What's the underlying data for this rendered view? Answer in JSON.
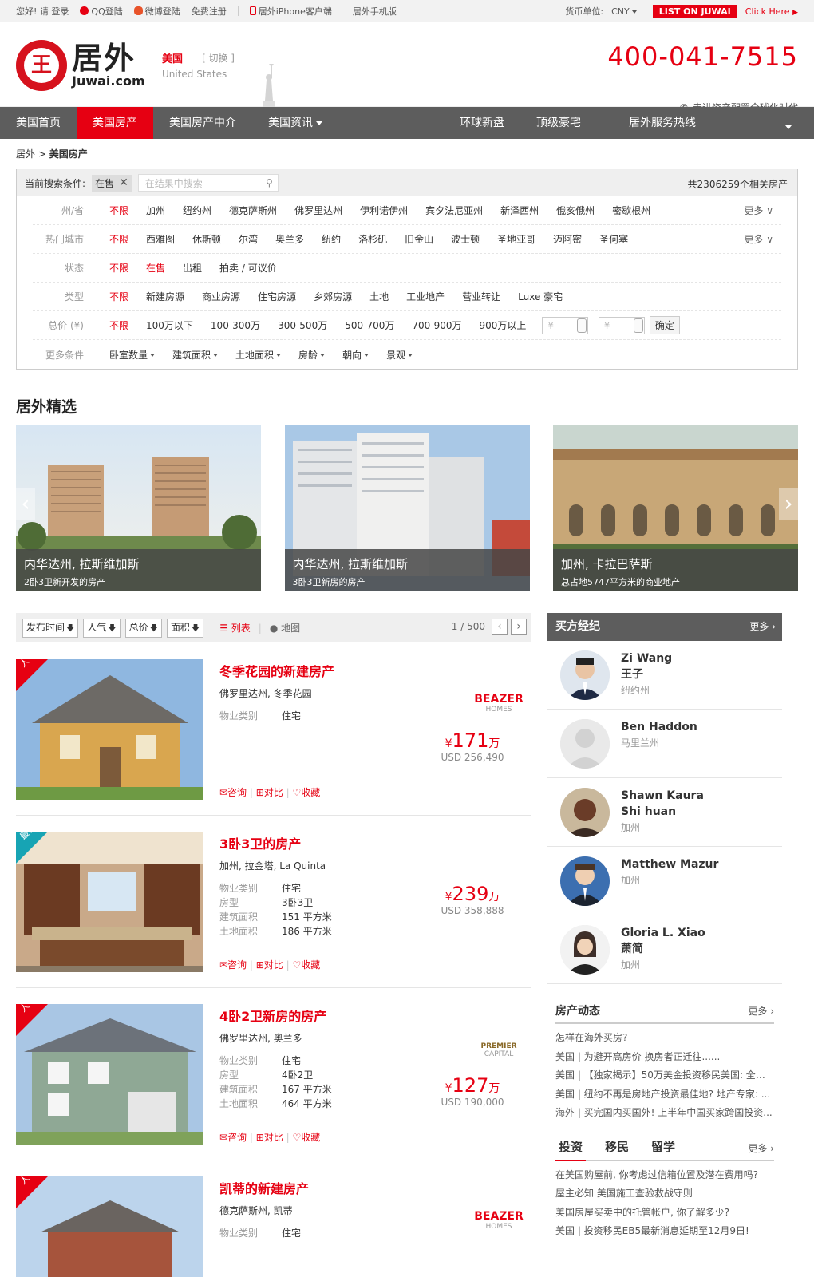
{
  "topbar": {
    "greeting": "您好! 请 登录",
    "qq_login": "QQ登陆",
    "weibo_login": "微博登陆",
    "register": "免费注册",
    "iphone_client": "居外iPhone客户端",
    "mobile_site": "居外手机版",
    "currency_label": "货币单位:",
    "currency_value": "CNY",
    "list_on": "LIST ON JUWAI",
    "click_here": "Click Here"
  },
  "header": {
    "logo_cn": "居外",
    "logo_en": "Juwai.com",
    "country": "美国",
    "switch": "[ 切换 ]",
    "country_en": "United States",
    "phone": "400-041-7515",
    "slogan": "走进资产配置全球化时代"
  },
  "nav": {
    "items": [
      "美国首页",
      "美国房产",
      "美国房产中介",
      "美国资讯"
    ],
    "right_items": [
      "环球新盘",
      "顶级豪宅",
      "居外服务热线"
    ]
  },
  "breadcrumb": {
    "root": "居外",
    "sep": ">",
    "current": "美国房产"
  },
  "filter": {
    "current_label": "当前搜索条件:",
    "tag": "在售",
    "search_placeholder": "在结果中搜索",
    "count": "共2306259个相关房产",
    "rows": [
      {
        "label": "州/省",
        "options": [
          "不限",
          "加州",
          "纽约州",
          "德克萨斯州",
          "佛罗里达州",
          "伊利诺伊州",
          "宾夕法尼亚州",
          "新泽西州",
          "俄亥俄州",
          "密歇根州"
        ],
        "more": "更多"
      },
      {
        "label": "热门城市",
        "options": [
          "不限",
          "西雅图",
          "休斯顿",
          "尔湾",
          "奥兰多",
          "纽约",
          "洛杉矶",
          "旧金山",
          "波士顿",
          "圣地亚哥",
          "迈阿密",
          "圣何塞"
        ],
        "more": "更多"
      },
      {
        "label": "状态",
        "options": [
          "不限",
          "在售",
          "出租",
          "拍卖 / 可议价"
        ]
      },
      {
        "label": "类型",
        "options": [
          "不限",
          "新建房源",
          "商业房源",
          "住宅房源",
          "乡郊房源",
          "土地",
          "工业地产",
          "营业转让",
          "Luxe 豪宅"
        ]
      },
      {
        "label": "总价 (¥)",
        "options": [
          "不限",
          "100万以下",
          "100-300万",
          "300-500万",
          "500-700万",
          "700-900万",
          "900万以上"
        ]
      },
      {
        "label": "更多条件",
        "options": [
          "卧室数量",
          "建筑面积",
          "土地面积",
          "房龄",
          "朝向",
          "景观"
        ]
      }
    ],
    "range_placeholder": "¥",
    "range_sep": "-",
    "confirm": "确定"
  },
  "featured": {
    "title": "居外精选",
    "cards": [
      {
        "title": "内华达州, 拉斯维加斯",
        "sub": "2卧3卫新开发的房产"
      },
      {
        "title": "内华达州, 拉斯维加斯",
        "sub": "3卧3卫新房的房产"
      },
      {
        "title": "加州, 卡拉巴萨斯",
        "sub": "总占地5747平方米的商业地产"
      }
    ]
  },
  "sort": {
    "buttons": [
      "发布时间",
      "人气",
      "总价",
      "面积"
    ],
    "list_view": "列表",
    "map_view": "地图",
    "page": "1 / 500"
  },
  "listings": [
    {
      "ribbon": "人气",
      "title": "冬季花园的新建房产",
      "location": "佛罗里达州, 冬季花园",
      "props": [
        {
          "k": "物业类别",
          "v": "住宅"
        }
      ],
      "price_num": "171",
      "price_unit": "万",
      "price_sym": "¥",
      "usd": "USD 256,490",
      "brand": "BEAZER",
      "brand_sub": "HOMES"
    },
    {
      "ribbon": "最新",
      "title": "3卧3卫的房产",
      "location": "加州, 拉金塔, La Quinta",
      "props": [
        {
          "k": "物业类别",
          "v": "住宅"
        },
        {
          "k": "房型",
          "v": "3卧3卫"
        },
        {
          "k": "建筑面积",
          "v": "151 平方米"
        },
        {
          "k": "土地面积",
          "v": "186 平方米"
        }
      ],
      "price_num": "239",
      "price_unit": "万",
      "price_sym": "¥",
      "usd": "USD 358,888"
    },
    {
      "ribbon": "人气",
      "title": "4卧2卫新房的房产",
      "location": "佛罗里达州, 奥兰多",
      "props": [
        {
          "k": "物业类别",
          "v": "住宅"
        },
        {
          "k": "房型",
          "v": "4卧2卫"
        },
        {
          "k": "建筑面积",
          "v": "167 平方米"
        },
        {
          "k": "土地面积",
          "v": "464 平方米"
        }
      ],
      "price_num": "127",
      "price_unit": "万",
      "price_sym": "¥",
      "usd": "USD 190,000",
      "brand": "PREMIER",
      "brand_sub": "CAPITAL"
    },
    {
      "ribbon": "人气",
      "title": "凯蒂的新建房产",
      "location": "德克萨斯州, 凯蒂",
      "props": [
        {
          "k": "物业类别",
          "v": "住宅"
        }
      ],
      "brand": "BEAZER",
      "brand_sub": "HOMES"
    }
  ],
  "actions": {
    "consult": "咨询",
    "compare": "对比",
    "favorite": "收藏"
  },
  "agents": {
    "title": "买方经纪",
    "more": "更多",
    "list": [
      {
        "name": "Zi Wang",
        "name2": "王子",
        "loc": "纽约州"
      },
      {
        "name": "Ben Haddon",
        "name2": "",
        "loc": "马里兰州"
      },
      {
        "name": "Shawn Kaura",
        "name2": "Shi huan",
        "loc": "加州"
      },
      {
        "name": "Matthew Mazur",
        "name2": "",
        "loc": "加州"
      },
      {
        "name": "Gloria L. Xiao",
        "name2": "萧简",
        "loc": "加州"
      }
    ]
  },
  "news": {
    "title": "房产动态",
    "more": "更多",
    "items": [
      "怎样在海外买房?",
      "美国 | 为避开高房价 换房者正迁往......",
      "美国 | 【独家揭示】50万美金投资移民美国: 全家...",
      "美国 | 纽约不再是房地产投资最佳地? 地产专家: ...",
      "海外 | 买完国内买国外! 上半年中国买家跨国投资..."
    ]
  },
  "invest": {
    "tabs": [
      "投资",
      "移民",
      "留学"
    ],
    "more": "更多",
    "items": [
      "在美国购屋前, 你考虑过信箱位置及潜在费用吗?",
      "屋主必知 美国施工查验救战守则",
      "美国房屋买卖中的托管帐户, 你了解多少?",
      "美国 | 投资移民EB5最新消息延期至12月9日!"
    ]
  },
  "colors": {
    "brand_red": "#e60012",
    "nav_gray": "#5d5d5d",
    "ribbon_teal": "#17a4b4"
  }
}
